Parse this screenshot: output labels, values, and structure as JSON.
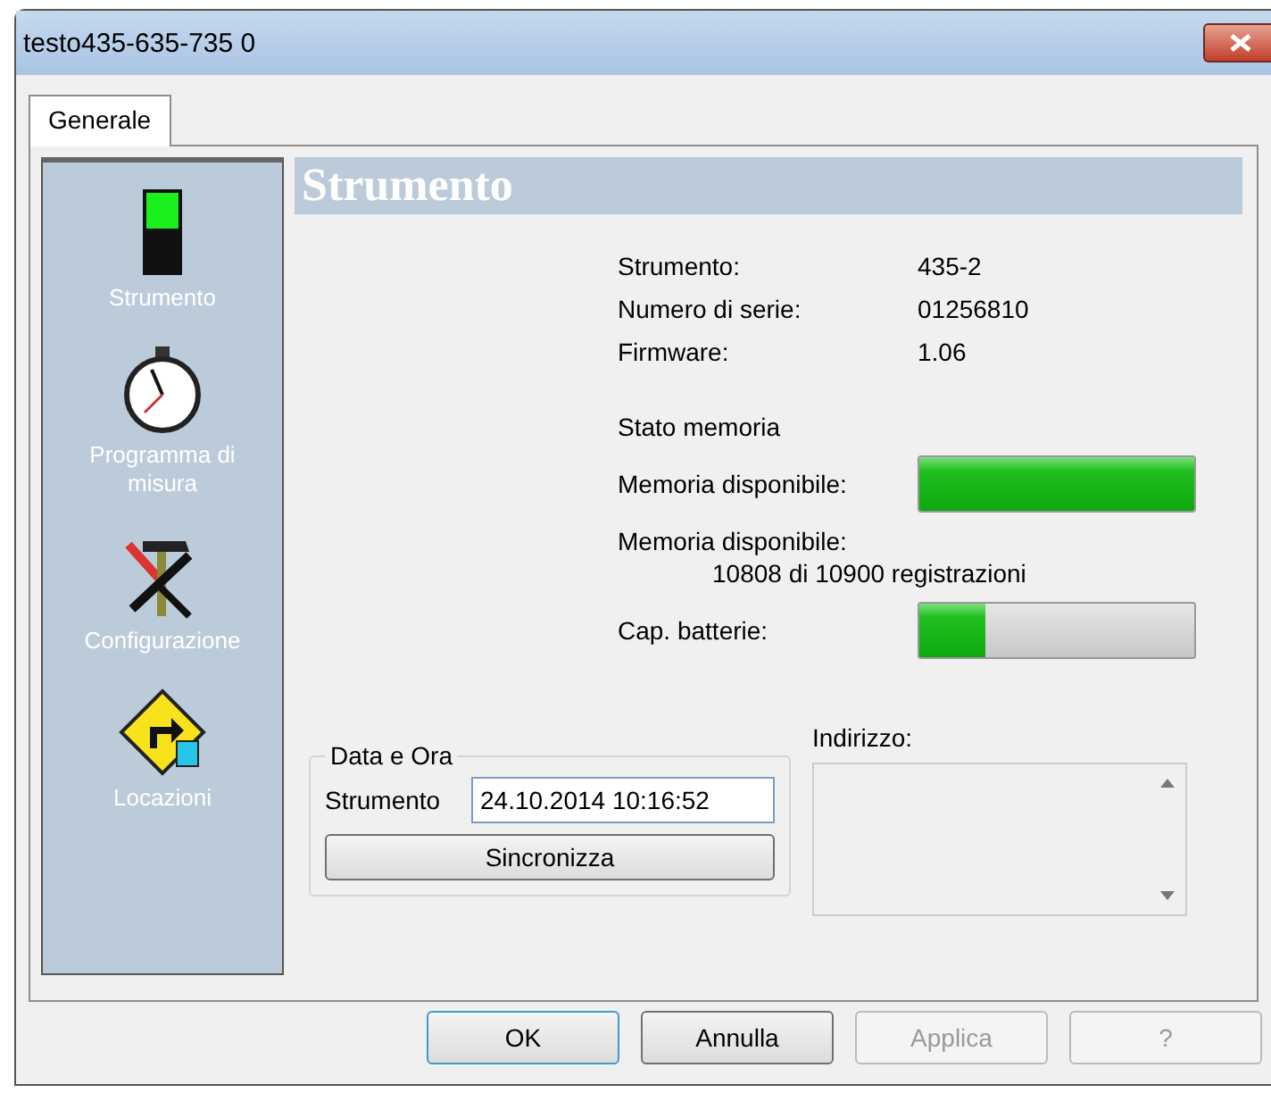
{
  "window": {
    "title": "testo435-635-735 0"
  },
  "tabs": [
    {
      "label": "Generale",
      "selected": true
    }
  ],
  "sidebar": {
    "items": [
      {
        "label": "Strumento",
        "kind": "instrument"
      },
      {
        "label": "Programma di misura",
        "kind": "stopwatch"
      },
      {
        "label": "Configurazione",
        "kind": "tools"
      },
      {
        "label": "Locazioni",
        "kind": "sign"
      }
    ]
  },
  "panel": {
    "title": "Strumento",
    "info": [
      {
        "label": "Strumento:",
        "value": "435-2"
      },
      {
        "label": "Numero di serie:",
        "value": "01256810"
      },
      {
        "label": "Firmware:",
        "value": "1.06"
      }
    ],
    "memory_heading": "Stato memoria",
    "memory_bar": {
      "label": "Memoria disponibile:",
      "level": 1.0
    },
    "memory_text_label": "Memoria disponibile:",
    "memory_text": "10808 di 10900 registrazioni",
    "battery_bar": {
      "label": "Cap. batterie:",
      "level": 0.24
    },
    "date_group": {
      "title": "Data e Ora",
      "field_label": "Strumento",
      "value": "24.10.2014 10:16:52",
      "button": "Sincronizza"
    },
    "address": {
      "label": "Indirizzo:"
    }
  },
  "buttons": [
    {
      "label": "OK",
      "default": true,
      "disabled": false
    },
    {
      "label": "Annulla",
      "default": false,
      "disabled": false
    },
    {
      "label": "Applica",
      "default": false,
      "disabled": true
    },
    {
      "label": "?",
      "default": false,
      "disabled": true
    }
  ]
}
